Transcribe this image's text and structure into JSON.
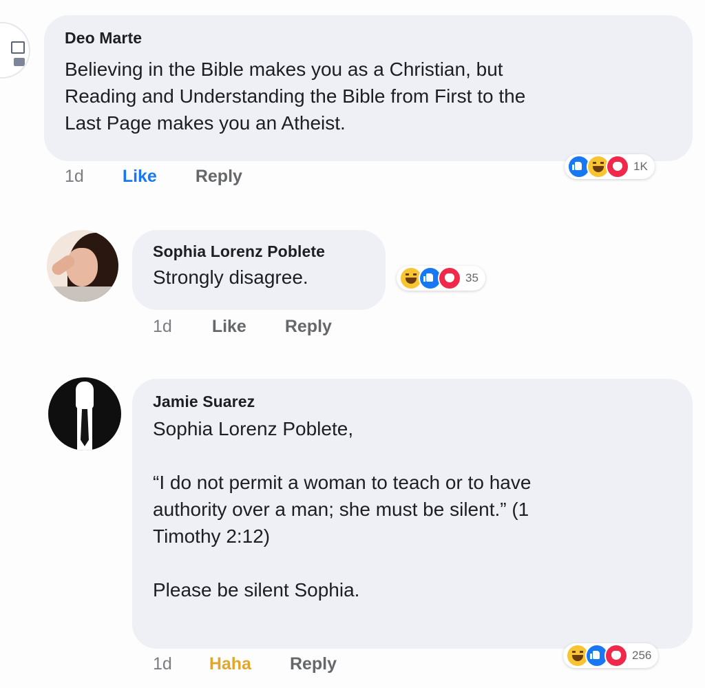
{
  "comments": [
    {
      "author": "Deo Marte",
      "text": "Believing in the Bible makes you as a Christian, but\nReading and Understanding the Bible from First to the\nLast Page makes you an Atheist.",
      "time": "1d",
      "action_label": "Like",
      "reply_label": "Reply",
      "reactions": [
        "like-icon",
        "haha-icon",
        "love-icon"
      ],
      "reaction_count": "1K"
    },
    {
      "author": "Sophia Lorenz Poblete",
      "text": "Strongly disagree.",
      "time": "1d",
      "action_label": "Like",
      "reply_label": "Reply",
      "reactions": [
        "haha-icon",
        "like-icon",
        "love-icon"
      ],
      "reaction_count": "35"
    },
    {
      "author": "Jamie Suarez",
      "text": "Sophia Lorenz Poblete,\n\n“I do not permit a woman to teach or to have\nauthority over a man; she must be silent.” (1\nTimothy 2:12)\n\nPlease be silent Sophia.",
      "time": "1d",
      "action_label": "Haha",
      "reply_label": "Reply",
      "reactions": [
        "haha-icon",
        "like-icon",
        "love-icon"
      ],
      "reaction_count": "256"
    }
  ],
  "colors": {
    "bubble": "#eff0f6",
    "like_active": "#1877f2",
    "haha_active": "#e1a62c",
    "muted": "#65676b"
  }
}
